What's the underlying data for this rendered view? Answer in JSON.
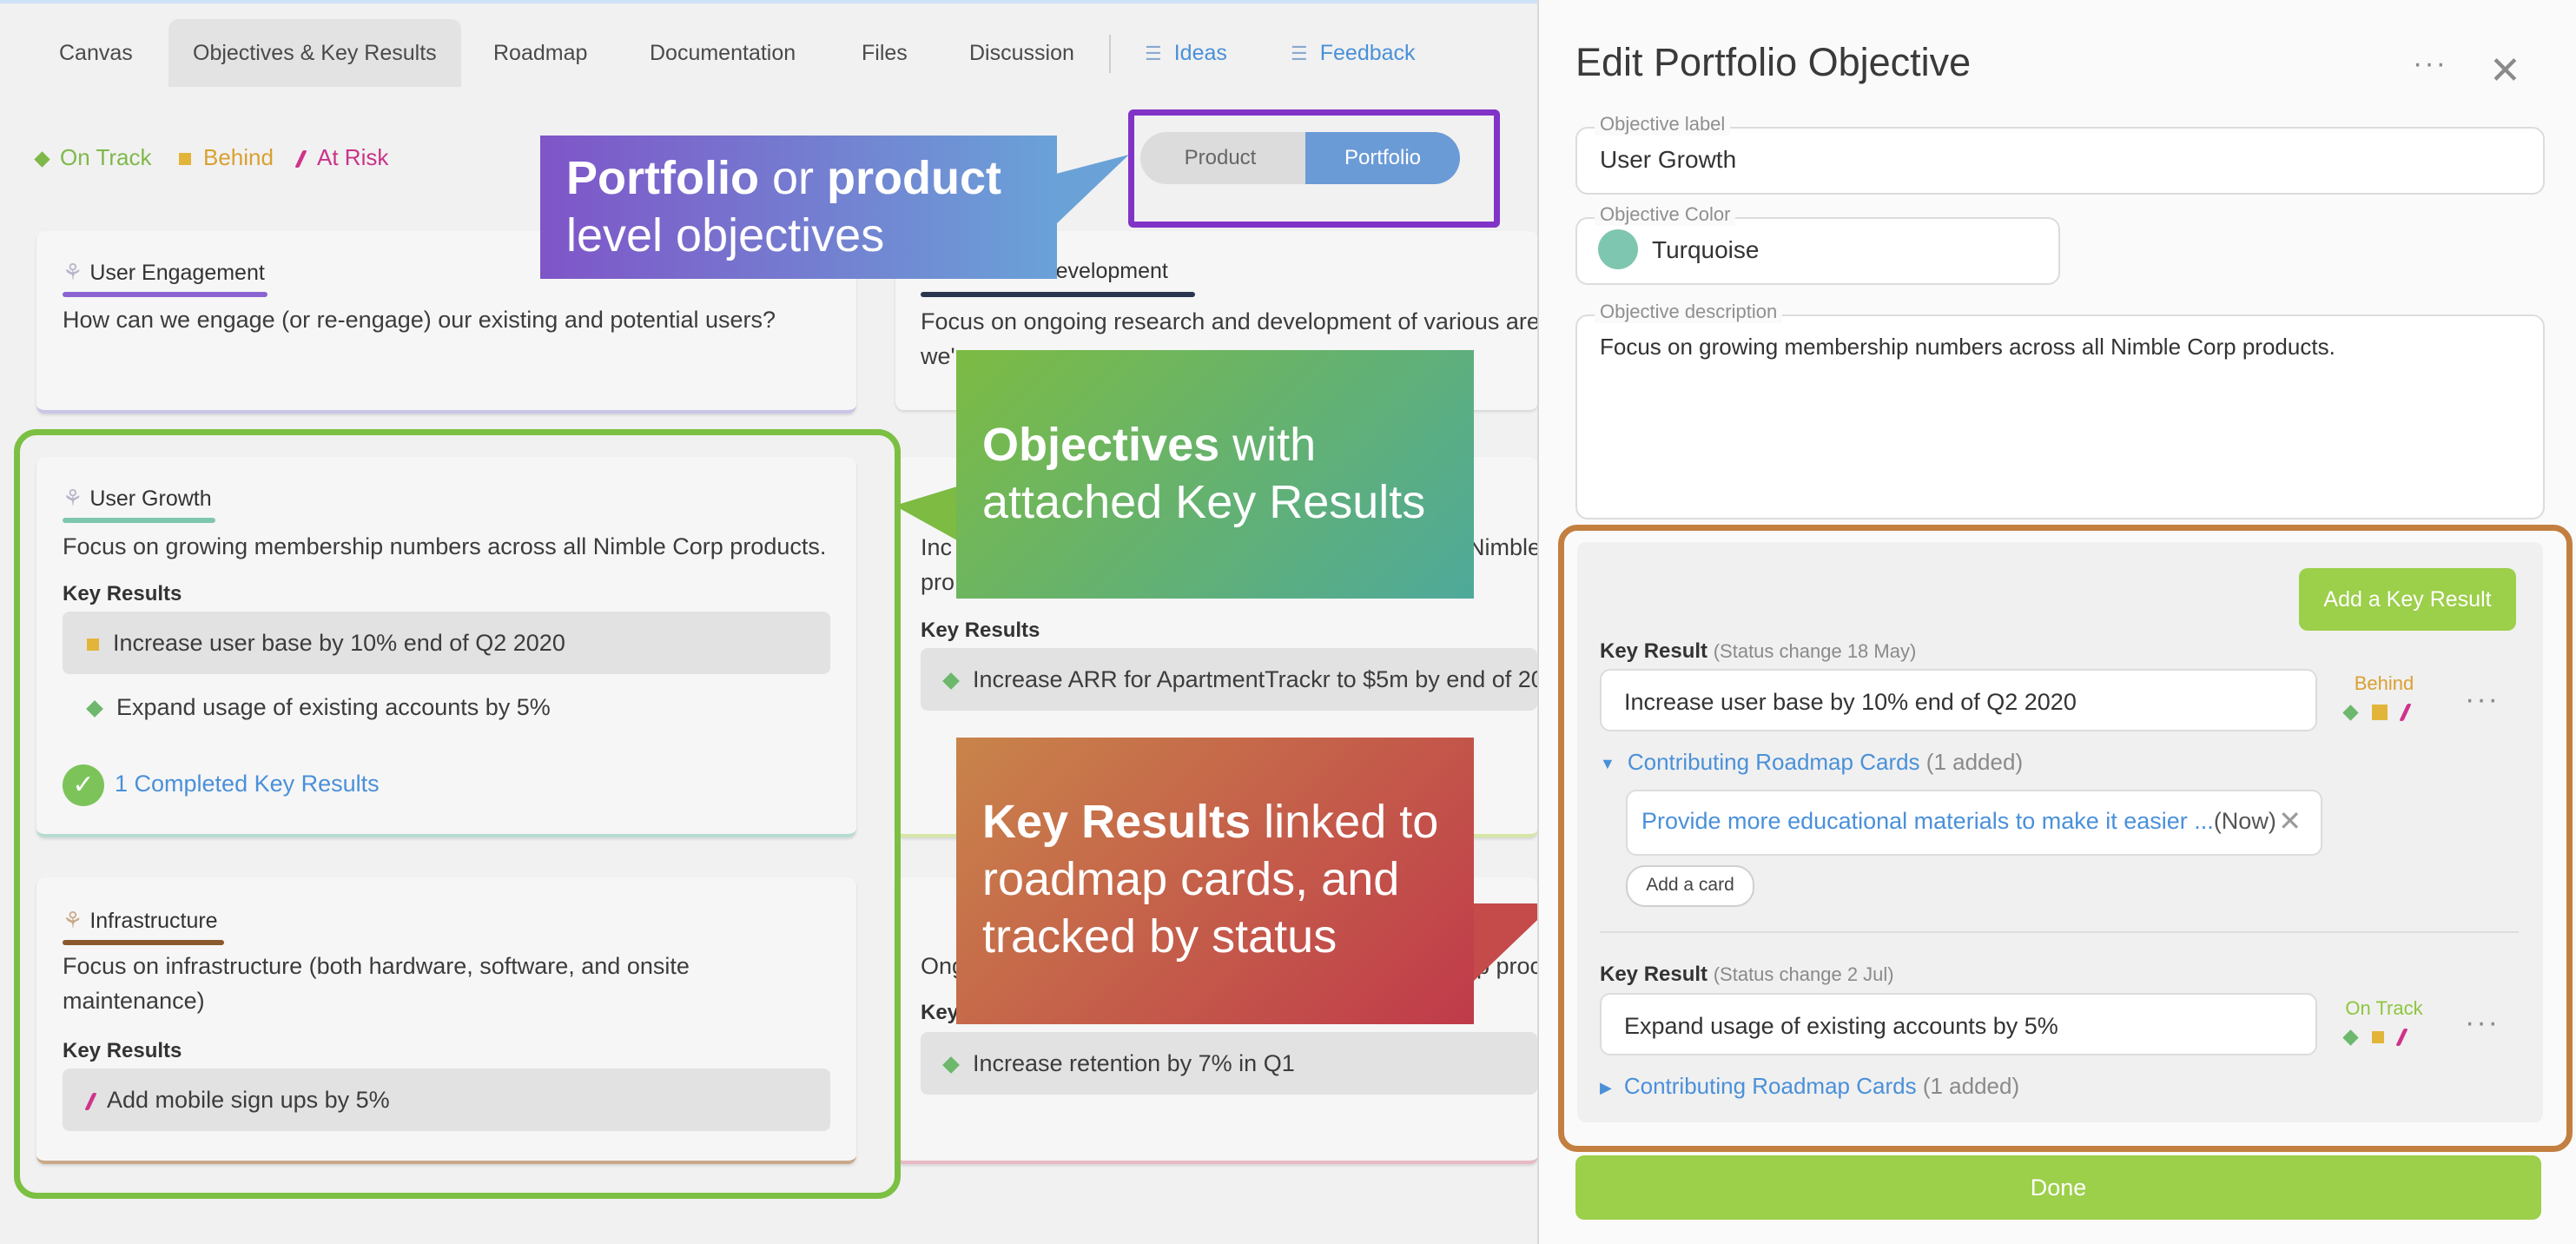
{
  "tabs": [
    "Canvas",
    "Objectives & Key Results",
    "Roadmap",
    "Documentation",
    "Files",
    "Discussion"
  ],
  "filter_tabs": [
    "Ideas",
    "Feedback"
  ],
  "legend": [
    {
      "label": "On Track",
      "color": "#7fb84a"
    },
    {
      "label": "Behind",
      "color": "#d9a031"
    },
    {
      "label": "At Risk",
      "color": "#c9338a"
    }
  ],
  "toggle": {
    "product": "Product",
    "portfolio": "Portfolio",
    "selected": "Portfolio"
  },
  "cards": {
    "user_engagement": {
      "title": "User Engagement",
      "desc": "How can we engage (or re-engage) our existing and potential users?"
    },
    "rnd": {
      "title": "Research & Development",
      "desc": "Focus on ongoing research and development of various area",
      "desc2": "we'..."
    },
    "user_growth": {
      "title": "User Growth",
      "desc": "Focus on growing membership numbers across all Nimble Corp products.",
      "kr_heading": "Key Results",
      "krs": [
        "Increase user base by 10% end of Q2 2020",
        "Expand usage of existing accounts by 5%"
      ],
      "completed": "1 Completed Key Results"
    },
    "mid": {
      "desc": "Inc",
      "desc_right": "Nimble",
      "desc2": "pro",
      "kr_heading": "Key Results",
      "kr": "Increase ARR for ApartmentTrackr to $5m by end of 20"
    },
    "infrastructure": {
      "title": "Infrastructure",
      "desc": "Focus on infrastructure (both hardware, software, and onsite maintenance)",
      "kr_heading": "Key Results",
      "kr": "Add mobile sign ups by 5%"
    },
    "bottom_mid": {
      "desc": "Ong",
      "desc_right": "p proc",
      "kr_heading": "Key",
      "kr": "Increase retention by 7% in Q1"
    }
  },
  "callouts": {
    "c1": {
      "b1": "Portfolio",
      "t1": " or ",
      "b2": "product",
      "t2": "level objectives"
    },
    "c2": {
      "b1": "Objectives",
      "t1": " with",
      "t2": "attached Key Results"
    },
    "c3": {
      "b1": "Key Results",
      "t1": " linked to",
      "t2": "roadmap cards, and",
      "t3": "tracked by status"
    }
  },
  "panel": {
    "title": "Edit Portfolio Objective",
    "more": "···",
    "close": "✕",
    "label_field": {
      "label": "Objective label",
      "value": "User Growth"
    },
    "color_field": {
      "label": "Objective Color",
      "value": "Turquoise",
      "swatch": "#7fc6b0"
    },
    "desc_field": {
      "label": "Objective description",
      "value": "Focus on growing membership numbers across all Nimble Corp products."
    },
    "add_kr": "Add a Key Result",
    "kr1": {
      "label": "Key Result",
      "meta": "(Status change 18 May)",
      "value": "Increase user base by 10% end of Q2 2020",
      "status": "Behind",
      "contrib": "Contributing Roadmap Cards",
      "contrib_count": "(1 added)",
      "card_text": "Provide more educational materials to make it easier ...",
      "card_tag": "(Now)",
      "add_card": "Add a card"
    },
    "kr2": {
      "label": "Key Result",
      "meta": "(Status change 2 Jul)",
      "value": "Expand usage of existing accounts by 5%",
      "status": "On Track",
      "contrib": "Contributing Roadmap Cards",
      "contrib_count": "(1 added)"
    },
    "done": "Done"
  }
}
